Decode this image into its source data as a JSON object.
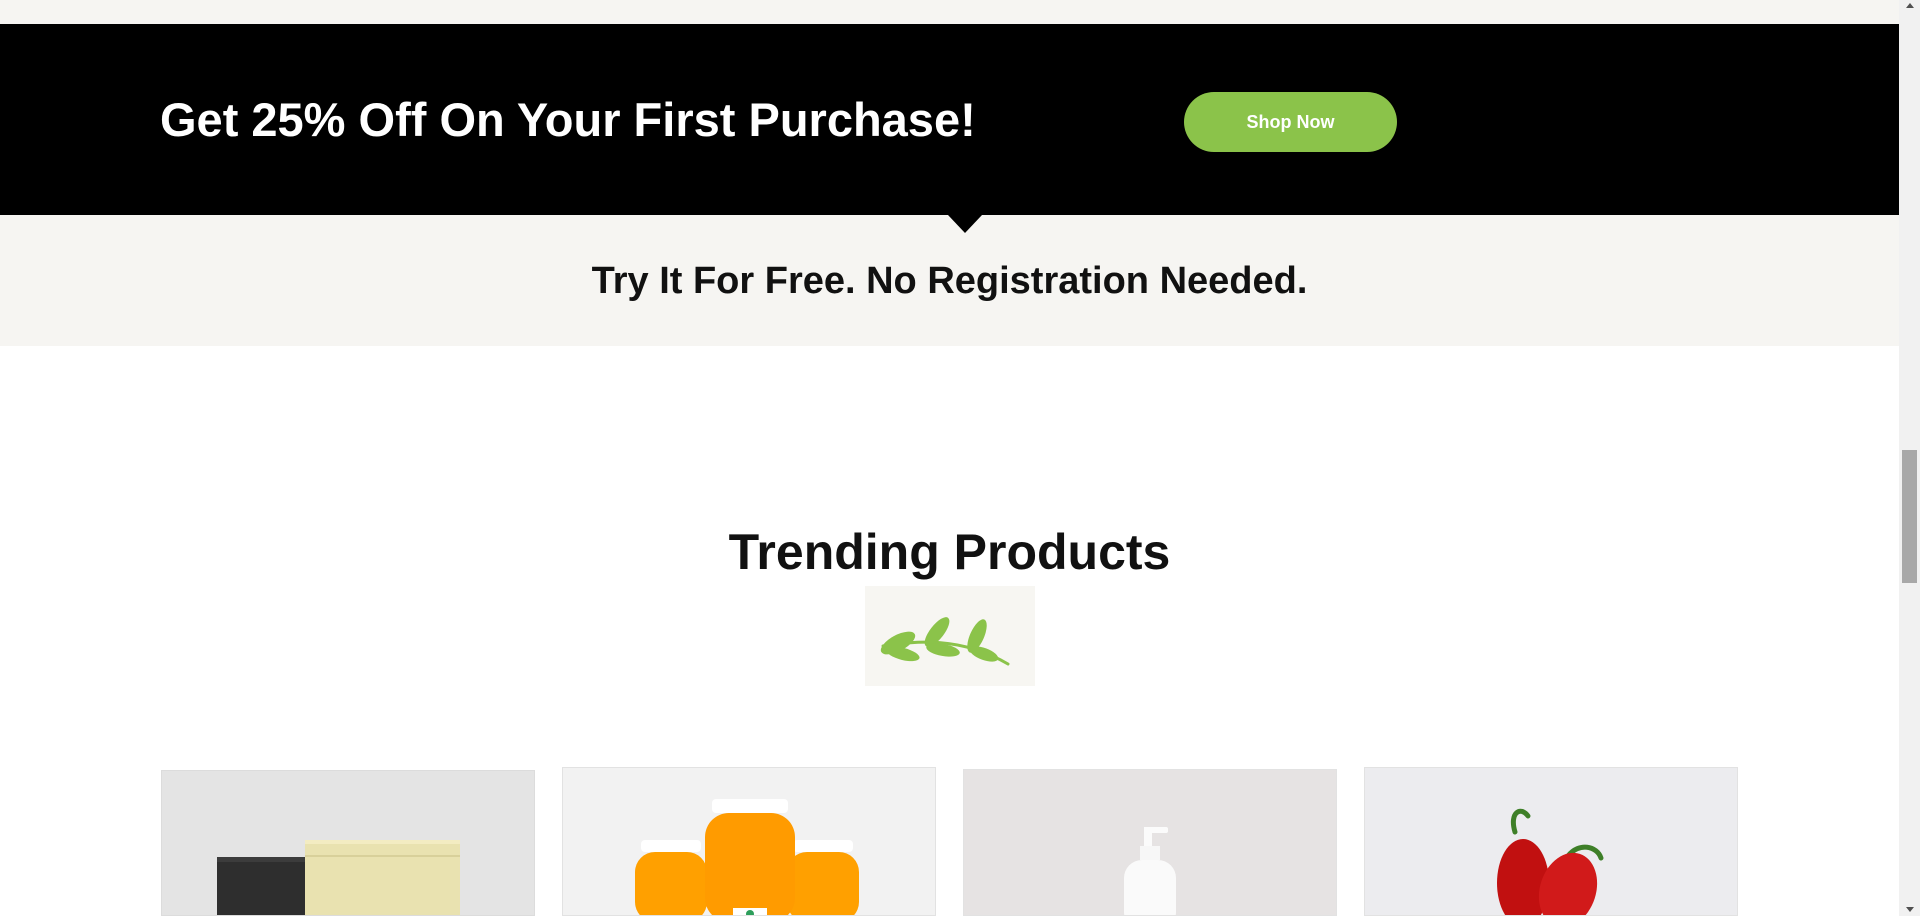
{
  "promo": {
    "title": "Get 25% Off On Your First Purchase!",
    "button_label": "Shop Now"
  },
  "free_band": {
    "text": "Try It For Free. No Registration Needed."
  },
  "trending": {
    "title": "Trending Products",
    "divider_icon": "leaf-branch-icon"
  },
  "products": [
    {
      "image": "pouch-bags-image"
    },
    {
      "image": "orange-juice-bottles-image"
    },
    {
      "image": "soap-pump-bottle-image"
    },
    {
      "image": "red-peppers-image"
    }
  ],
  "colors": {
    "accent": "#8bc34a",
    "promo_background": "#000000",
    "band_background": "#f6f5f2"
  }
}
